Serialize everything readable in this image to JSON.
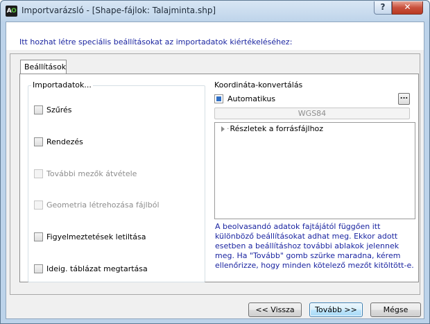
{
  "window": {
    "title": "Importvarázsló - [Shape-fájlok: Talajminta.shp]",
    "app_icon_text": "A",
    "app_icon_text_o": "O",
    "help_label": "?",
    "close_label": "✕"
  },
  "header": {
    "intro": "Itt hozhat létre speciális beállításokat az importadatok kiértékeléséhez:"
  },
  "tabs": [
    {
      "label": "Beállítások",
      "selected": true
    }
  ],
  "import_group": {
    "legend": "Importadatok...",
    "options": [
      {
        "label": "Szűrés",
        "checked": false,
        "enabled": true
      },
      {
        "label": "Rendezés",
        "checked": false,
        "enabled": true
      },
      {
        "label": "További mezők átvétele",
        "checked": false,
        "enabled": false
      },
      {
        "label": "Geometria létrehozása fájlból",
        "checked": false,
        "enabled": false
      },
      {
        "label": "Figyelmeztetések letiltása",
        "checked": false,
        "enabled": true
      },
      {
        "label": "Ideig. táblázat megtartása",
        "checked": false,
        "enabled": true
      }
    ]
  },
  "coord_group": {
    "legend": "Koordináta-konvertálás",
    "auto_label": "Automatikus",
    "auto_checked": true,
    "browse_label": "...",
    "system_value": "WGS84",
    "details_node": "Részletek a forrásfájlhoz",
    "info_text": "A beolvasandó adatok fajtájától függően itt különböző beállításokat adhat meg. Ekkor adott esetben a beállításhoz további ablakok jelennek meg. Ha  \"Tovább\" gomb szürke maradna, kérem ellenőrizze, hogy minden kötelező mezőt kitöltött-e."
  },
  "footer": {
    "back_label": "<< Vissza",
    "next_label": "Tovább >>",
    "cancel_label": "Mégse"
  },
  "colors": {
    "info_blue": "#1a24a0",
    "title_bg": "#bcd3ea",
    "close_red": "#c9503c"
  }
}
